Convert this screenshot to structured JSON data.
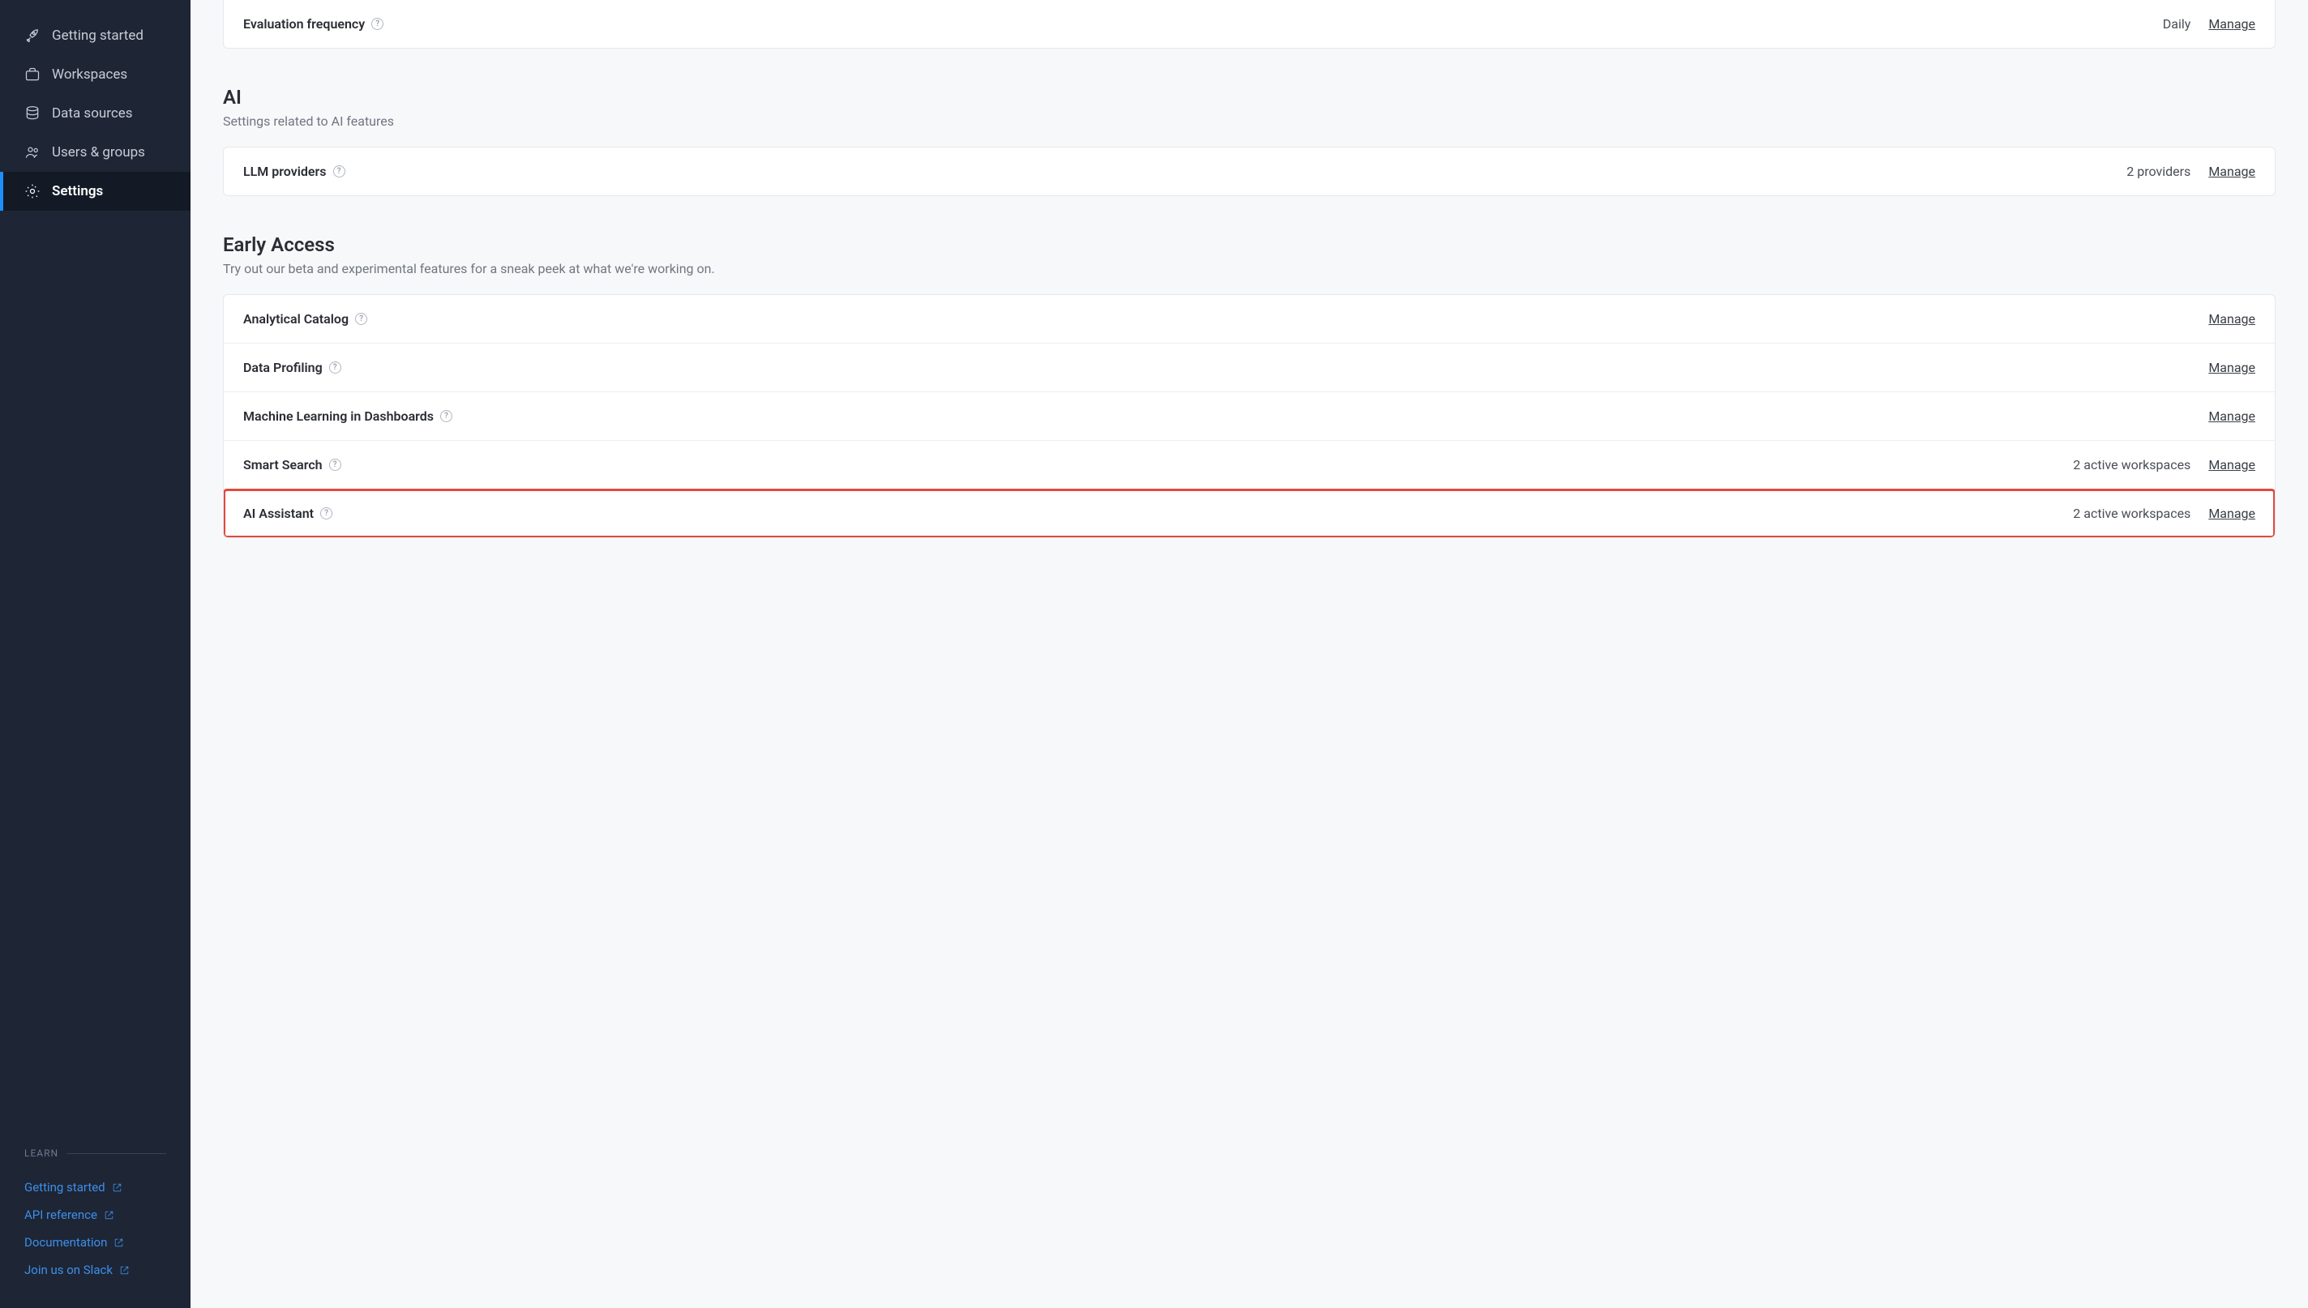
{
  "sidebar": {
    "nav": [
      {
        "label": "Getting started"
      },
      {
        "label": "Workspaces"
      },
      {
        "label": "Data sources"
      },
      {
        "label": "Users & groups"
      },
      {
        "label": "Settings"
      }
    ],
    "learn_header": "LEARN",
    "learn_links": [
      {
        "label": "Getting started"
      },
      {
        "label": "API reference"
      },
      {
        "label": "Documentation"
      },
      {
        "label": "Join us on Slack"
      }
    ]
  },
  "top_card": {
    "rows": [
      {
        "label": "Evaluation frequency",
        "value": "Daily",
        "manage": "Manage"
      }
    ]
  },
  "ai_section": {
    "title": "AI",
    "subtitle": "Settings related to AI features",
    "rows": [
      {
        "label": "LLM providers",
        "value": "2 providers",
        "manage": "Manage"
      }
    ]
  },
  "early_access": {
    "title": "Early Access",
    "subtitle": "Try out our beta and experimental features for a sneak peek at what we're working on.",
    "rows": [
      {
        "label": "Analytical Catalog",
        "value": "",
        "manage": "Manage"
      },
      {
        "label": "Data Profiling",
        "value": "",
        "manage": "Manage"
      },
      {
        "label": "Machine Learning in Dashboards",
        "value": "",
        "manage": "Manage"
      },
      {
        "label": "Smart Search",
        "value": "2 active workspaces",
        "manage": "Manage"
      },
      {
        "label": "AI Assistant",
        "value": "2 active workspaces",
        "manage": "Manage"
      }
    ]
  }
}
